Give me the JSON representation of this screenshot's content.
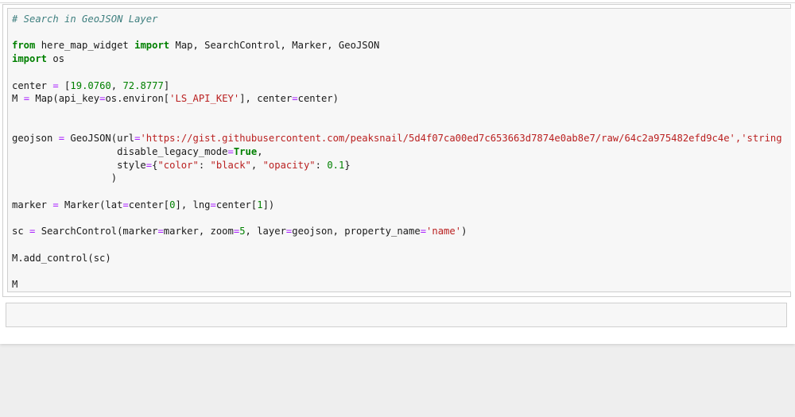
{
  "notebook": {
    "cells": [
      {
        "type": "code",
        "lines": [
          [
            {
              "t": "# Search in GeoJSON Layer",
              "c": "comment"
            }
          ],
          [],
          [
            {
              "t": "from",
              "c": "keyword"
            },
            {
              "t": " here_map_widget "
            },
            {
              "t": "import",
              "c": "keyword"
            },
            {
              "t": " Map, SearchControl, Marker, GeoJSON"
            }
          ],
          [
            {
              "t": "import",
              "c": "keyword"
            },
            {
              "t": " os"
            }
          ],
          [],
          [
            {
              "t": "center "
            },
            {
              "t": "=",
              "c": "operator"
            },
            {
              "t": " ["
            },
            {
              "t": "19.0760",
              "c": "number"
            },
            {
              "t": ", "
            },
            {
              "t": "72.8777",
              "c": "number"
            },
            {
              "t": "]"
            }
          ],
          [
            {
              "t": "M "
            },
            {
              "t": "=",
              "c": "operator"
            },
            {
              "t": " Map(api_key"
            },
            {
              "t": "=",
              "c": "operator"
            },
            {
              "t": "os.environ["
            },
            {
              "t": "'LS_API_KEY'",
              "c": "string"
            },
            {
              "t": "], center"
            },
            {
              "t": "=",
              "c": "operator"
            },
            {
              "t": "center)"
            }
          ],
          [],
          [],
          [
            {
              "t": "geojson "
            },
            {
              "t": "=",
              "c": "operator"
            },
            {
              "t": " GeoJSON(url"
            },
            {
              "t": "=",
              "c": "operator"
            },
            {
              "t": "'https://gist.githubusercontent.com/peaksnail/5d4f07ca00ed7c653663d7874e0ab8e7/raw/64c2a975482efd9c4e','string",
              "c": "string"
            }
          ],
          [
            {
              "t": "                  disable_legacy_mode"
            },
            {
              "t": "=",
              "c": "operator"
            },
            {
              "t": "True",
              "c": "keyword"
            },
            {
              "t": ","
            }
          ],
          [
            {
              "t": "                  style"
            },
            {
              "t": "=",
              "c": "operator"
            },
            {
              "t": "{"
            },
            {
              "t": "\"color\"",
              "c": "string"
            },
            {
              "t": ": "
            },
            {
              "t": "\"black\"",
              "c": "string"
            },
            {
              "t": ", "
            },
            {
              "t": "\"opacity\"",
              "c": "string"
            },
            {
              "t": ": "
            },
            {
              "t": "0.1",
              "c": "number"
            },
            {
              "t": "}"
            }
          ],
          [
            {
              "t": "                 )"
            }
          ],
          [],
          [
            {
              "t": "marker "
            },
            {
              "t": "=",
              "c": "operator"
            },
            {
              "t": " Marker(lat"
            },
            {
              "t": "=",
              "c": "operator"
            },
            {
              "t": "center["
            },
            {
              "t": "0",
              "c": "number"
            },
            {
              "t": "], lng"
            },
            {
              "t": "=",
              "c": "operator"
            },
            {
              "t": "center["
            },
            {
              "t": "1",
              "c": "number"
            },
            {
              "t": "])"
            }
          ],
          [],
          [
            {
              "t": "sc "
            },
            {
              "t": "=",
              "c": "operator"
            },
            {
              "t": " SearchControl(marker"
            },
            {
              "t": "=",
              "c": "operator"
            },
            {
              "t": "marker, zoom"
            },
            {
              "t": "=",
              "c": "operator"
            },
            {
              "t": "5",
              "c": "number"
            },
            {
              "t": ", layer"
            },
            {
              "t": "=",
              "c": "operator"
            },
            {
              "t": "geojson, property_name"
            },
            {
              "t": "=",
              "c": "operator"
            },
            {
              "t": "'name'",
              "c": "string"
            },
            {
              "t": ")"
            }
          ],
          [],
          [
            {
              "t": "M.add_control(sc)"
            }
          ],
          [],
          [
            {
              "t": "M"
            }
          ]
        ]
      },
      {
        "type": "code",
        "lines": []
      }
    ]
  },
  "colors": {
    "comment": "#408080",
    "keyword": "#008000",
    "number": "#008000",
    "string": "#ba2121",
    "operator": "#aa22ff"
  }
}
